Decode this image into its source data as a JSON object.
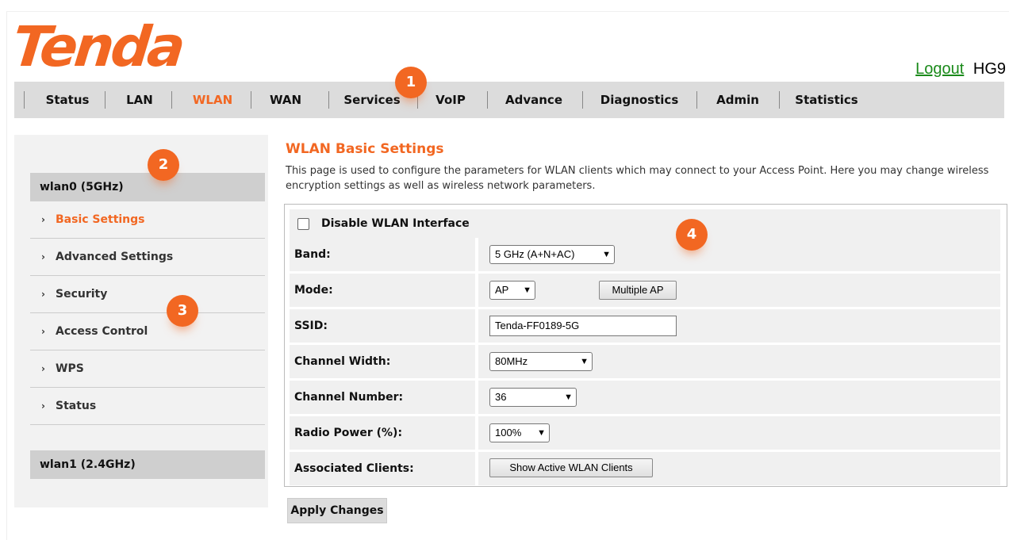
{
  "brand": {
    "logo_text": "Tenda",
    "logout": "Logout",
    "model": "HG9"
  },
  "nav": [
    "Status",
    "LAN",
    "WLAN",
    "WAN",
    "Services",
    "VoIP",
    "Advance",
    "Diagnostics",
    "Admin",
    "Statistics"
  ],
  "nav_active": "WLAN",
  "badges": [
    "1",
    "2",
    "3",
    "4"
  ],
  "sidebar": {
    "group1": "wlan0 (5GHz)",
    "items": [
      "Basic Settings",
      "Advanced Settings",
      "Security",
      "Access Control",
      "WPS",
      "Status"
    ],
    "active": "Basic Settings",
    "group2": "wlan1 (2.4GHz)",
    "chevron": "›"
  },
  "main": {
    "title": "WLAN Basic Settings",
    "description": "This page is used to configure the parameters for WLAN clients which may connect to your Access Point. Here you may change wireless encryption settings as well as wireless network parameters."
  },
  "form": {
    "disable_label": "Disable WLAN Interface",
    "band_label": "Band:",
    "band_value": "5 GHz (A+N+AC)",
    "mode_label": "Mode:",
    "mode_value": "AP",
    "multiple_ap": "Multiple AP",
    "ssid_label": "SSID:",
    "ssid_value": "Tenda-FF0189-5G",
    "width_label": "Channel Width:",
    "width_value": "80MHz",
    "channel_label": "Channel Number:",
    "channel_value": "36",
    "power_label": "Radio Power (%):",
    "power_value": "100%",
    "clients_label": "Associated Clients:",
    "clients_button": "Show Active WLAN Clients"
  },
  "apply": "Apply Changes",
  "colors": {
    "accent": "#f26722",
    "link": "#1a8a1a",
    "nav_bg": "#dcdcdc"
  }
}
